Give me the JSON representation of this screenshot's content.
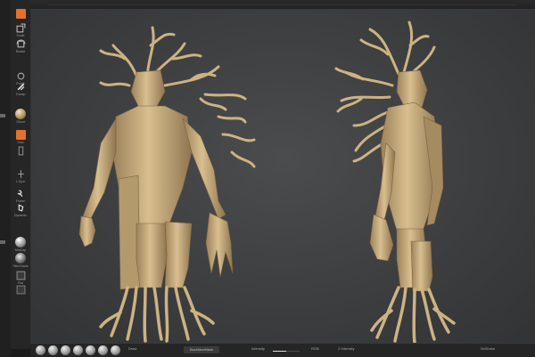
{
  "left_panel": {
    "tools": [
      {
        "id": "move",
        "icon": "move-icon",
        "label": ""
      },
      {
        "id": "scale",
        "icon": "scale-icon",
        "label": "Scale"
      },
      {
        "id": "rotate",
        "icon": "rotate-icon",
        "label": "Rotate"
      },
      {
        "id": "polyf",
        "icon": "polyframe-icon",
        "label": "PolyF"
      },
      {
        "id": "transp",
        "icon": "transparency-icon",
        "label": "Transp"
      },
      {
        "id": "ghost",
        "icon": "ghost-icon",
        "label": "Ghost"
      },
      {
        "id": "solo",
        "icon": "solo-icon",
        "label": "Solo"
      },
      {
        "id": "xpose",
        "icon": "xpose-icon",
        "label": "Xpose"
      },
      {
        "id": "lsym",
        "icon": "local-symmetry-icon",
        "label": "L.Sym"
      },
      {
        "id": "frame",
        "icon": "frame-icon",
        "label": "Frame"
      },
      {
        "id": "dynamic",
        "icon": "dynamic-icon",
        "label": "Dynamic"
      },
      {
        "id": "matcap",
        "icon": "matcap-icon",
        "label": "MatCap"
      },
      {
        "id": "skin",
        "icon": "skin-icon",
        "label": "SkinShade"
      },
      {
        "id": "flat",
        "icon": "flat-icon",
        "label": "Flat"
      }
    ]
  },
  "bottom_bar": {
    "backface_label": "BackfaceMask",
    "backface_button": "BackfaceMask",
    "field1_label": "Intensity",
    "field2_label": "Draw",
    "field3_label": "RGB",
    "field4_label": "Z Intensity",
    "right_label": "SnShoke",
    "intensity_level": 0.5
  },
  "colors": {
    "model": "#d7be8d",
    "model_shadow": "#8c7450",
    "background": "#3f4042",
    "accent": "#e3722a"
  }
}
